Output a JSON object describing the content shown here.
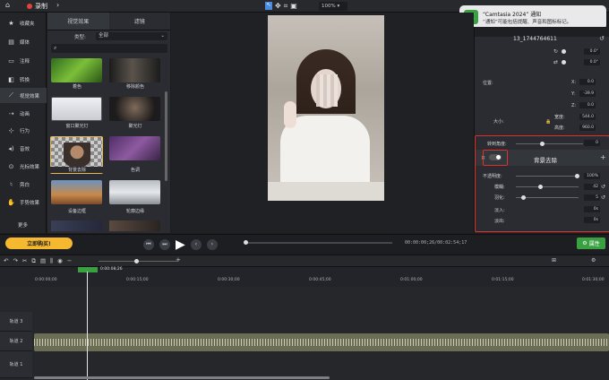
{
  "topbar": {
    "record_label": "录制",
    "zoom": "100%"
  },
  "toast": {
    "title": "“Camtasia 2024” 通知",
    "body": "“通知”可能包括提醒、声音和图标标记。"
  },
  "nav": [
    {
      "label": "收藏夹",
      "icon": "star-icon"
    },
    {
      "label": "媒体",
      "icon": "film-icon"
    },
    {
      "label": "注释",
      "icon": "annotation-icon"
    },
    {
      "label": "转换",
      "icon": "transition-icon"
    },
    {
      "label": "视觉效果",
      "icon": "magic-wand-icon"
    },
    {
      "label": "动画",
      "icon": "animation-icon"
    },
    {
      "label": "行为",
      "icon": "behavior-icon"
    },
    {
      "label": "音效",
      "icon": "audio-icon"
    },
    {
      "label": "光标效果",
      "icon": "cursor-icon"
    },
    {
      "label": "旁白",
      "icon": "microphone-icon"
    },
    {
      "label": "手势效果",
      "icon": "hand-icon"
    },
    {
      "label": "更多",
      "icon": ""
    }
  ],
  "library": {
    "tabs": [
      "视觉效果",
      "滤镜"
    ],
    "type_label": "类型:",
    "type_value": "全部",
    "items": [
      "着色",
      "移除颜色",
      "窗口聚光灯",
      "聚光灯",
      "背景去除",
      "色调",
      "设备边框",
      "轮廓边缘"
    ]
  },
  "properties": {
    "clip_name": "13_1744764611",
    "rotation": [
      "0.0°",
      "0.0°"
    ],
    "position_label": "位置:",
    "position": {
      "x": "0.0",
      "y": "-39.9",
      "z": "0.0"
    },
    "size_label": "大小:",
    "width_label": "宽度:",
    "width": "544.0",
    "height_label": "高度:",
    "height": "960.0",
    "corner_label": "转到角度:",
    "corner_value": "0",
    "effect_title": "背景去除",
    "opacity_label": "不透明度:",
    "opacity": "100%",
    "opacity_level": 1.0,
    "edge_label": "模糊:",
    "edge": "42",
    "feather_label": "羽化:",
    "feather": "5",
    "fadein_label": "淡入:",
    "fadein": "0s",
    "fadeout_label": "淡出:",
    "fadeout": "0s"
  },
  "transport": {
    "buy_label": "立即购买!",
    "timecode": "00:00:00;26/00:02:54;17",
    "properties_label": "属性"
  },
  "timeline": {
    "playhead": "0:00:08;26",
    "ticks": [
      "0:00:00;00",
      "0:00:15;00",
      "0:00:30;00",
      "0:00:45;00",
      "0:01:00;00",
      "0:01:15;00",
      "0:01:30;00"
    ],
    "tracks": [
      "轨道 3",
      "轨道 2",
      "轨道 1"
    ]
  },
  "colors": {
    "accent": "#3aa142",
    "record": "#e0443a",
    "highlight": "#e0302a",
    "buy": "#f5b82e"
  }
}
